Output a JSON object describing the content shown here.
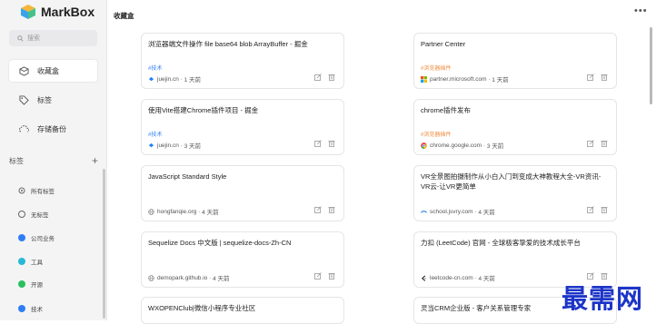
{
  "app": {
    "name": "MarkBox",
    "logo_icon": "cube-logo-icon"
  },
  "sidebar": {
    "search_placeholder": "搜索",
    "nav": [
      {
        "label": "收藏盒",
        "icon": "cube-icon",
        "active": true
      },
      {
        "label": "标签",
        "icon": "tag-icon",
        "active": false
      },
      {
        "label": "存储备份",
        "icon": "cloud-sync-icon",
        "active": false
      }
    ],
    "tags_header": "标签",
    "tags_add": "+",
    "tags": [
      {
        "label": "所有标签",
        "kind": "all"
      },
      {
        "label": "无标签",
        "kind": "none"
      },
      {
        "label": "公司业务",
        "color": "#2f7df6"
      },
      {
        "label": "工具",
        "color": "#28b9d6"
      },
      {
        "label": "开源",
        "color": "#2bbf5f"
      },
      {
        "label": "技术",
        "color": "#2f7df6"
      }
    ]
  },
  "main": {
    "title": "收藏盒",
    "more_icon": "ellipsis-icon",
    "cards": [
      {
        "title": "浏览器端文件操作 file base64 blob ArrayBuffer - 掘金",
        "tag": "#技术",
        "tag_color": "#2f7df6",
        "site": "juejin.cn",
        "time": "1 天前",
        "favicon": "juejin-icon"
      },
      {
        "title": "Partner Center",
        "tag": "#浏览器插件",
        "tag_color": "#f08a3c",
        "site": "partner.microsoft.com",
        "time": "1 天前",
        "favicon": "microsoft-icon"
      },
      {
        "title": "使用Vite搭建Chrome插件项目 - 掘金",
        "tag": "#技术",
        "tag_color": "#2f7df6",
        "site": "juejin.cn",
        "time": "3 天前",
        "favicon": "juejin-icon"
      },
      {
        "title": "chrome插件发布",
        "tag": "#浏览器插件",
        "tag_color": "#f08a3c",
        "site": "chrome.google.com",
        "time": "3 天前",
        "favicon": "chrome-icon"
      },
      {
        "title": "JavaScript Standard Style",
        "tag": "",
        "tag_color": "",
        "site": "hongfanqie.org",
        "time": "4 天前",
        "favicon": "globe-icon"
      },
      {
        "title": "VR全景图拍摄制作从小白入门到变成大神教程大全-VR资讯-VR云-让VR更简单",
        "tag": "",
        "tag_color": "",
        "site": "school.jsvry.com",
        "time": "4 天前",
        "favicon": "jsvry-icon"
      },
      {
        "title": "Sequelize Docs 中文版 | sequelize-docs-Zh-CN",
        "tag": "",
        "tag_color": "",
        "site": "demopark.github.io",
        "time": "4 天前",
        "favicon": "globe-icon"
      },
      {
        "title": "力扣 (LeetCode) 官网 - 全球极客挚爱的技术成长平台",
        "tag": "",
        "tag_color": "",
        "site": "leetcode-cn.com",
        "time": "4 天前",
        "favicon": "leetcode-icon"
      },
      {
        "title": "WXOPENClub|微信小程序专业社区",
        "tag": "",
        "tag_color": "",
        "site": "",
        "time": "",
        "favicon": ""
      },
      {
        "title": "灵当CRM企业版 - 客户关系管理专家",
        "tag": "",
        "tag_color": "",
        "site": "",
        "time": "",
        "favicon": ""
      }
    ]
  },
  "watermark": "最需网"
}
